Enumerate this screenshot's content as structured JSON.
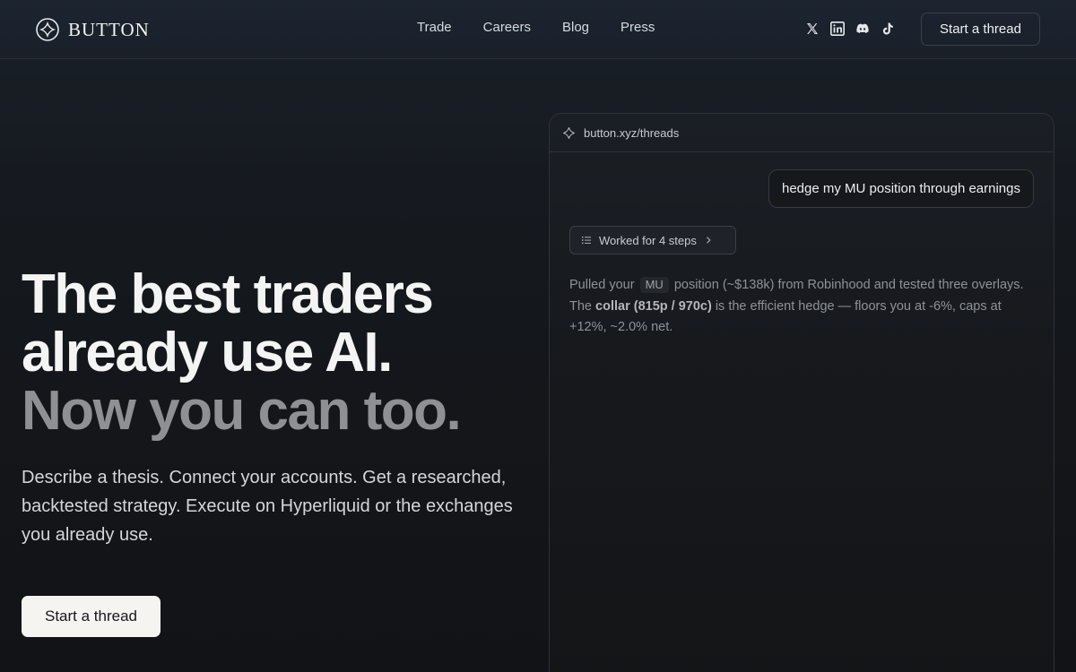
{
  "brand": {
    "name": "BUTTON"
  },
  "nav": {
    "items": [
      {
        "label": "Trade"
      },
      {
        "label": "Careers"
      },
      {
        "label": "Blog"
      },
      {
        "label": "Press"
      }
    ]
  },
  "socials": [
    {
      "icon": "x-icon"
    },
    {
      "icon": "linkedin-icon"
    },
    {
      "icon": "discord-icon"
    },
    {
      "icon": "tiktok-icon"
    }
  ],
  "header": {
    "cta_label": "Start a thread"
  },
  "hero": {
    "title_line1": "The best traders",
    "title_line2": "already use AI.",
    "title_line3": "Now you can too.",
    "description": "Describe a thesis. Connect your accounts. Get a researched, backtested strategy. Execute on Hyperliquid or the exchanges you already use.",
    "cta_label": "Start a thread"
  },
  "thread": {
    "url": "button.xyz/threads",
    "user_message": "hedge my MU position through earnings",
    "steps_label": "Worked for 4 steps",
    "answer": {
      "part1": "Pulled your",
      "ticker": "MU",
      "part2": "position (~$138k) from Robinhood and tested three overlays. The",
      "highlight": "collar (815p / 970c)",
      "part3": "is the efficient hedge — floors you at -6%, caps at +12%, ~2.0% net."
    }
  },
  "colors": {
    "background": "#121316",
    "header_bg": "#1c2430",
    "muted_title": "#8f9094",
    "cta_bg": "#f6f4f1"
  }
}
